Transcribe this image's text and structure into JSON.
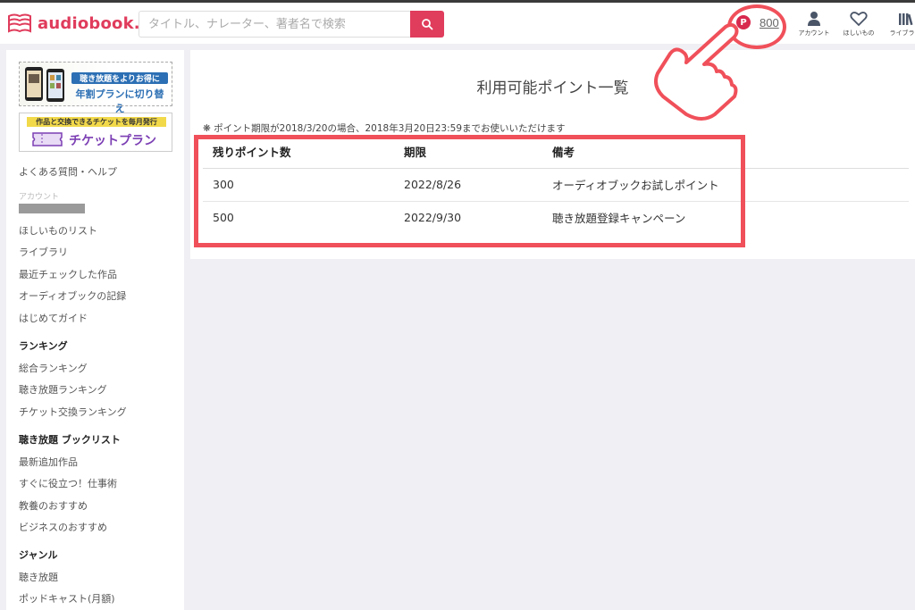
{
  "header": {
    "logo_text": "audiobook.jp",
    "search_placeholder": "タイトル、ナレーター、著者名で検索",
    "points_badge": "P",
    "points_value": "800",
    "nav": [
      {
        "label": "アカウント",
        "icon": "person-icon"
      },
      {
        "label": "ほしいもの",
        "icon": "heart-icon"
      },
      {
        "label": "ライブラリ",
        "icon": "library-icon"
      }
    ]
  },
  "sidebar": {
    "banner_subscription": {
      "line1": "聴き放題をよりお得に",
      "line2": "年割プランに切り替え"
    },
    "banner_ticket": {
      "line1": "作品と交換できるチケットを毎月発行",
      "line2": "チケットプラン"
    },
    "help_link": "よくある質問・ヘルプ",
    "account_label": "アカウント",
    "account_links": [
      "ほしいものリスト",
      "ライブラリ",
      "最近チェックした作品",
      "オーディオブックの記録",
      "はじめてガイド"
    ],
    "sections": [
      {
        "title": "ランキング",
        "links": [
          "総合ランキング",
          "聴き放題ランキング",
          "チケット交換ランキング"
        ]
      },
      {
        "title": "聴き放題 ブックリスト",
        "links": [
          "最新追加作品",
          "すぐに役立つ！仕事術",
          "教養のおすすめ",
          "ビジネスのおすすめ"
        ]
      },
      {
        "title": "ジャンル",
        "links": [
          "聴き放題",
          "ポッドキャスト(月額)"
        ]
      }
    ]
  },
  "main": {
    "title": "利用可能ポイント一覧",
    "note": "ポイント期限が2018/3/20の場合、2018年3月20日23:59までお使いいただけます",
    "table": {
      "headers": [
        "残りポイント数",
        "期限",
        "備考"
      ],
      "rows": [
        [
          "300",
          "2022/8/26",
          "オーディオブックお試しポイント"
        ],
        [
          "500",
          "2022/9/30",
          "聴き放題登録キャンペーン"
        ]
      ]
    }
  },
  "colors": {
    "brand": "#e03c5c",
    "highlight": "#f0505a",
    "sidebar_bg": "#ffffff",
    "page_bg": "#f0f0f4"
  }
}
